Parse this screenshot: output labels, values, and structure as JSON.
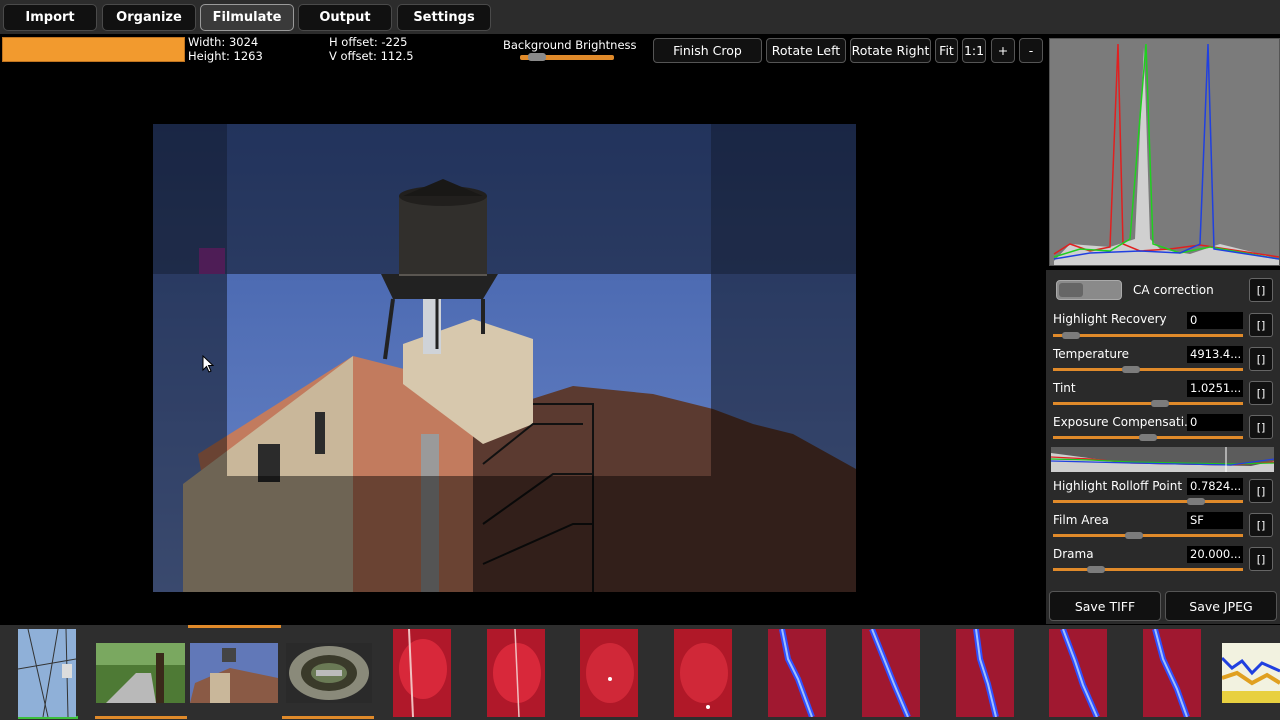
{
  "tabs": [
    {
      "label": "Import"
    },
    {
      "label": "Organize"
    },
    {
      "label": "Filmulate"
    },
    {
      "label": "Output"
    },
    {
      "label": "Settings"
    }
  ],
  "active_tab": "Filmulate",
  "info": {
    "width": "Width: 3024",
    "height": "Height: 1263",
    "h_offset": "H offset: -225",
    "v_offset": "V offset: 112.5"
  },
  "background_brightness": {
    "label": "Background Brightness",
    "value": 0.1
  },
  "toolbar": {
    "finish_crop": "Finish Crop",
    "rotate_left": "Rotate Left",
    "rotate_right": "Rotate Right",
    "fit": "Fit",
    "one_to_one": "1:1",
    "zoom_in": "+",
    "zoom_out": "-"
  },
  "controls": {
    "ca_correction": "CA correction",
    "bracket": "[]",
    "items": [
      {
        "label": "Highlight Recovery",
        "value": "0",
        "pos": 0.05
      },
      {
        "label": "Temperature",
        "value": "4913.4...",
        "pos": 0.4
      },
      {
        "label": "Tint",
        "value": "1.0251...",
        "pos": 0.57
      },
      {
        "label": "Exposure Compensati...",
        "value": "0",
        "pos": 0.5
      },
      {
        "label": "Highlight Rolloff Point",
        "value": "0.7824...",
        "pos": 0.78
      },
      {
        "label": "Film Area",
        "value": "SF",
        "pos": 0.42
      },
      {
        "label": "Drama",
        "value": "20.000...",
        "pos": 0.2
      }
    ]
  },
  "save": {
    "tiff": "Save TIFF",
    "jpeg": "Save JPEG"
  },
  "colors": {
    "accent": "#f29a2e",
    "panel": "#2a2a2a"
  }
}
